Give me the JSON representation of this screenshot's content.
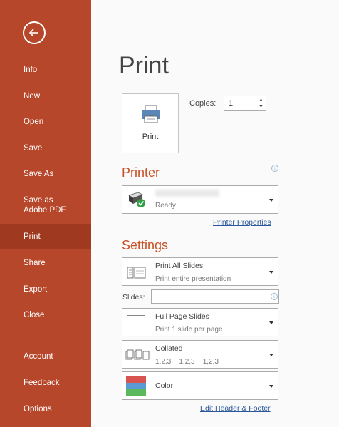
{
  "sidebar": {
    "items": [
      {
        "label": "Info"
      },
      {
        "label": "New"
      },
      {
        "label": "Open"
      },
      {
        "label": "Save"
      },
      {
        "label": "Save As"
      },
      {
        "label": "Save as Adobe PDF"
      },
      {
        "label": "Print",
        "active": true
      },
      {
        "label": "Share"
      },
      {
        "label": "Export"
      },
      {
        "label": "Close"
      },
      {
        "label": "Account"
      },
      {
        "label": "Feedback"
      },
      {
        "label": "Options"
      }
    ]
  },
  "page": {
    "title": "Print"
  },
  "print_button": {
    "label": "Print"
  },
  "copies": {
    "label": "Copies:",
    "value": "1"
  },
  "printer": {
    "section_title": "Printer",
    "status": "Ready",
    "properties_link": "Printer Properties"
  },
  "settings": {
    "section_title": "Settings",
    "slides_range": {
      "main": "Print All Slides",
      "sub": "Print entire presentation"
    },
    "slides_label": "Slides:",
    "layout": {
      "main": "Full Page Slides",
      "sub": "Print 1 slide per page"
    },
    "collation": {
      "main": "Collated",
      "sub": "1,2,3    1,2,3    1,2,3"
    },
    "color": {
      "main": "Color"
    },
    "header_footer_link": "Edit Header & Footer"
  },
  "colors": {
    "accent": "#b7472a",
    "active_nav": "#9f3a20",
    "section_title": "#c75128",
    "link": "#2b579a"
  }
}
